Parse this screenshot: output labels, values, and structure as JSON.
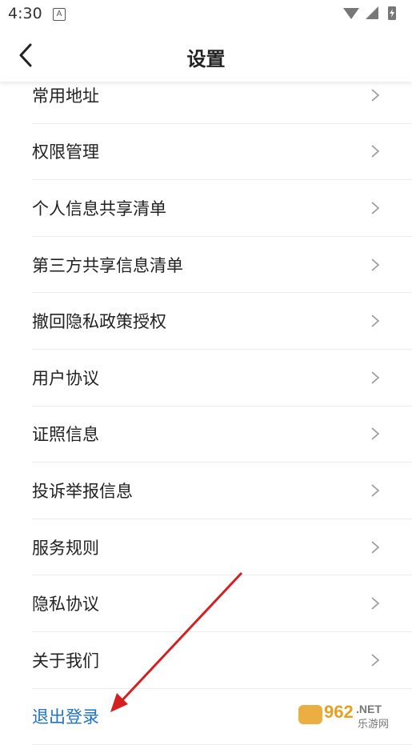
{
  "status": {
    "time": "4:30",
    "notification_icon": "A"
  },
  "header": {
    "title": "设置"
  },
  "menu_items": [
    {
      "label": "常用地址"
    },
    {
      "label": "权限管理"
    },
    {
      "label": "个人信息共享清单"
    },
    {
      "label": "第三方共享信息清单"
    },
    {
      "label": "撤回隐私政策授权"
    },
    {
      "label": "用户协议"
    },
    {
      "label": "证照信息"
    },
    {
      "label": "投诉举报信息"
    },
    {
      "label": "服务规则"
    },
    {
      "label": "隐私协议"
    },
    {
      "label": "关于我们"
    }
  ],
  "logout": {
    "label": "退出登录"
  },
  "watermark": {
    "text1": "962",
    "text2": ".NET",
    "text3": "乐游网"
  },
  "colors": {
    "accent": "#1e73c8",
    "arrow": "#d42020"
  }
}
